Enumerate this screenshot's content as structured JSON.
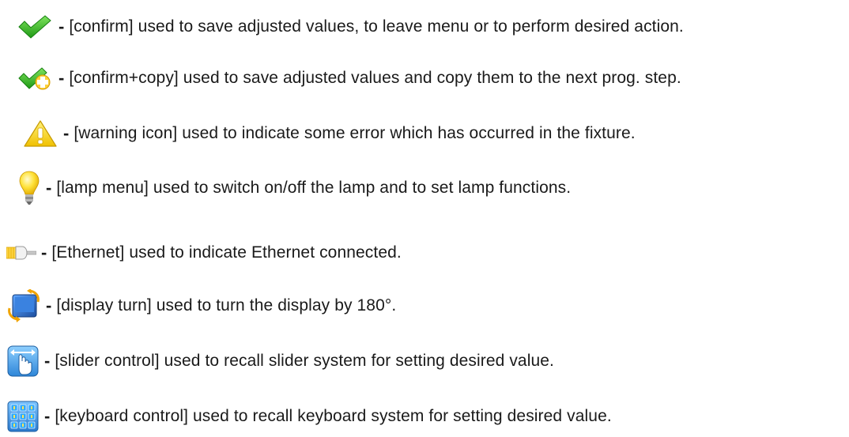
{
  "items": [
    {
      "icon": "checkmark-icon",
      "dash": "-",
      "text": "[confirm] used to save adjusted values, to leave menu or to perform desired action."
    },
    {
      "icon": "checkmark-plus-icon",
      "dash": "-",
      "text": "[confirm+copy] used to save adjusted values and copy them to the next prog. step."
    },
    {
      "icon": "warning-icon",
      "dash": "-",
      "text": "[warning icon] used to indicate some error which has occurred in the fixture."
    },
    {
      "icon": "lamp-bulb-icon",
      "dash": "-",
      "text": "[lamp menu] used to switch on/off the lamp and to set lamp functions."
    },
    {
      "icon": "ethernet-plug-icon",
      "dash": "-",
      "text": "[Ethernet] used to indicate Ethernet connected."
    },
    {
      "icon": "display-turn-icon",
      "dash": "-",
      "text": "[display turn] used to turn the display by 180°."
    },
    {
      "icon": "slider-hand-icon",
      "dash": "-",
      "text": "[slider control] used to recall slider system for setting desired value."
    },
    {
      "icon": "keypad-icon",
      "dash": "-",
      "text": "[keyboard control] used to recall keyboard system for setting desired value."
    }
  ],
  "colors": {
    "check_green": "#3bb52a",
    "warning_yellow": "#f4d000",
    "bulb_yellow": "#ffe23a",
    "blue": "#2d7fd0"
  }
}
